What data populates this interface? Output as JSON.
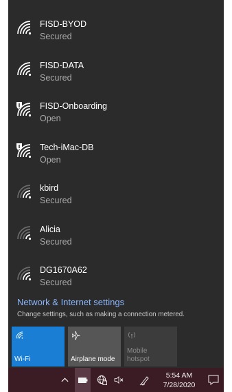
{
  "networks": [
    {
      "name": "FISD-BYOD",
      "status": "Secured",
      "icon": "wifi-secured-icon",
      "strength": 4,
      "shield": false
    },
    {
      "name": "FISD-DATA",
      "status": "Secured",
      "icon": "wifi-secured-icon",
      "strength": 4,
      "shield": false
    },
    {
      "name": "FISD-Onboarding",
      "status": "Open",
      "icon": "wifi-open-shield-icon",
      "strength": 4,
      "shield": true
    },
    {
      "name": "Tech-iMac-DB",
      "status": "Open",
      "icon": "wifi-open-shield-icon",
      "strength": 4,
      "shield": true
    },
    {
      "name": "kbird",
      "status": "Secured",
      "icon": "wifi-weak-icon",
      "strength": 2,
      "shield": false
    },
    {
      "name": "Alicia",
      "status": "Secured",
      "icon": "wifi-weak-icon",
      "strength": 1,
      "shield": false
    },
    {
      "name": "DG1670A62",
      "status": "Secured",
      "icon": "wifi-weak-icon",
      "strength": 2,
      "shield": false
    }
  ],
  "settings": {
    "link": "Network & Internet settings",
    "subtitle": "Change settings, such as making a connection metered."
  },
  "tiles": {
    "wifi": "Wi-Fi",
    "airplane": "Airplane mode",
    "hotspot_line1": "Mobile",
    "hotspot_line2": "hotspot"
  },
  "taskbar": {
    "time": "5:54 AM",
    "date": "7/28/2020"
  },
  "colors": {
    "flyout_bg": "#2b2b2b",
    "accent": "#1a7fd4",
    "link": "#8ab4f8",
    "taskbar_bg": "#3b1b24"
  }
}
